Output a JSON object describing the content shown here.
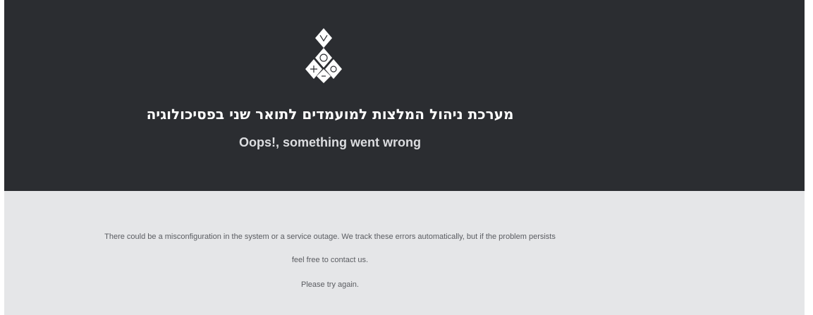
{
  "header": {
    "logo": "institution-logo-icon",
    "title": "מערכת ניהול המלצות למועמדים לתואר שני בפסיכולוגיה",
    "subtitle": "Oops!, something went wrong"
  },
  "message": {
    "line1": "There could be a misconfiguration in the system or a service outage. We track these errors automatically, but if the problem persists",
    "line2": "feel free to contact us.",
    "line3": "Please try again."
  },
  "colors": {
    "header_bg": "#2b2d31",
    "body_bg": "#e5e6e8",
    "title_text": "#ffffff",
    "message_text": "#5a5c61"
  }
}
